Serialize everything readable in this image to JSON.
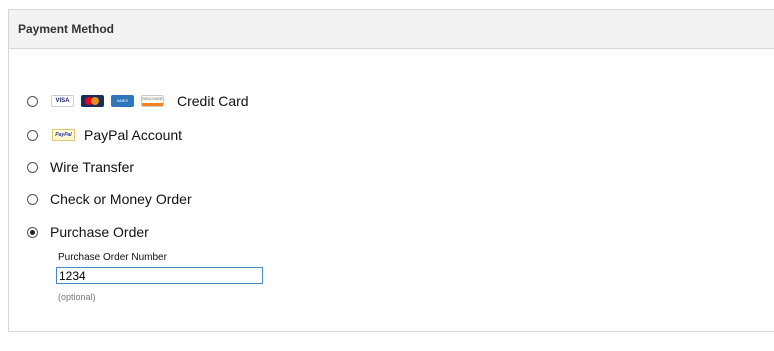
{
  "panel": {
    "title": "Payment Method"
  },
  "options": [
    {
      "label": "Credit Card",
      "checked": false,
      "icons": [
        "visa-icon",
        "mastercard-icon",
        "amex-icon",
        "discover-icon"
      ]
    },
    {
      "label": "PayPal Account",
      "checked": false,
      "icons": [
        "paypal-icon"
      ]
    },
    {
      "label": "Wire Transfer",
      "checked": false
    },
    {
      "label": "Check or Money Order",
      "checked": false
    },
    {
      "label": "Purchase Order",
      "checked": true
    }
  ],
  "card_icons": {
    "visa": "VISA",
    "amex": "AMEX",
    "discover": "DISCOVER",
    "paypal": "PayPal"
  },
  "purchase_order": {
    "field_label": "Purchase Order Number",
    "value": "1234",
    "hint": "(optional)"
  },
  "colors": {
    "header_bg": "#f3f3f3",
    "border": "#d7d7d7",
    "input_border": "#4a88c9"
  }
}
